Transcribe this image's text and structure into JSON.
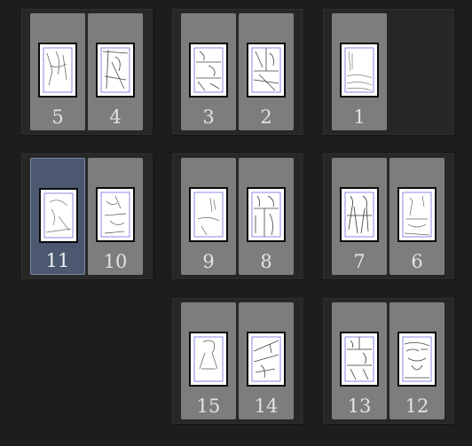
{
  "accent_color": "#4b586f",
  "page_color": "#7d7d7d",
  "selected_page": "11",
  "spreads": [
    {
      "row": 1,
      "pages": [
        {
          "number": "5",
          "selected": false
        },
        {
          "number": "4",
          "selected": false
        }
      ]
    },
    {
      "row": 1,
      "pages": [
        {
          "number": "3",
          "selected": false
        },
        {
          "number": "2",
          "selected": false
        }
      ]
    },
    {
      "row": 1,
      "pages": [
        {
          "number": "1",
          "selected": false
        }
      ]
    },
    {
      "row": 2,
      "pages": [
        {
          "number": "11",
          "selected": true
        },
        {
          "number": "10",
          "selected": false
        }
      ]
    },
    {
      "row": 2,
      "pages": [
        {
          "number": "9",
          "selected": false
        },
        {
          "number": "8",
          "selected": false
        }
      ]
    },
    {
      "row": 2,
      "pages": [
        {
          "number": "7",
          "selected": false
        },
        {
          "number": "6",
          "selected": false
        }
      ]
    },
    {
      "row": 3,
      "pages": [
        {
          "number": "15",
          "selected": false
        },
        {
          "number": "14",
          "selected": false
        }
      ]
    },
    {
      "row": 3,
      "pages": [
        {
          "number": "13",
          "selected": false
        },
        {
          "number": "12",
          "selected": false
        }
      ]
    }
  ]
}
